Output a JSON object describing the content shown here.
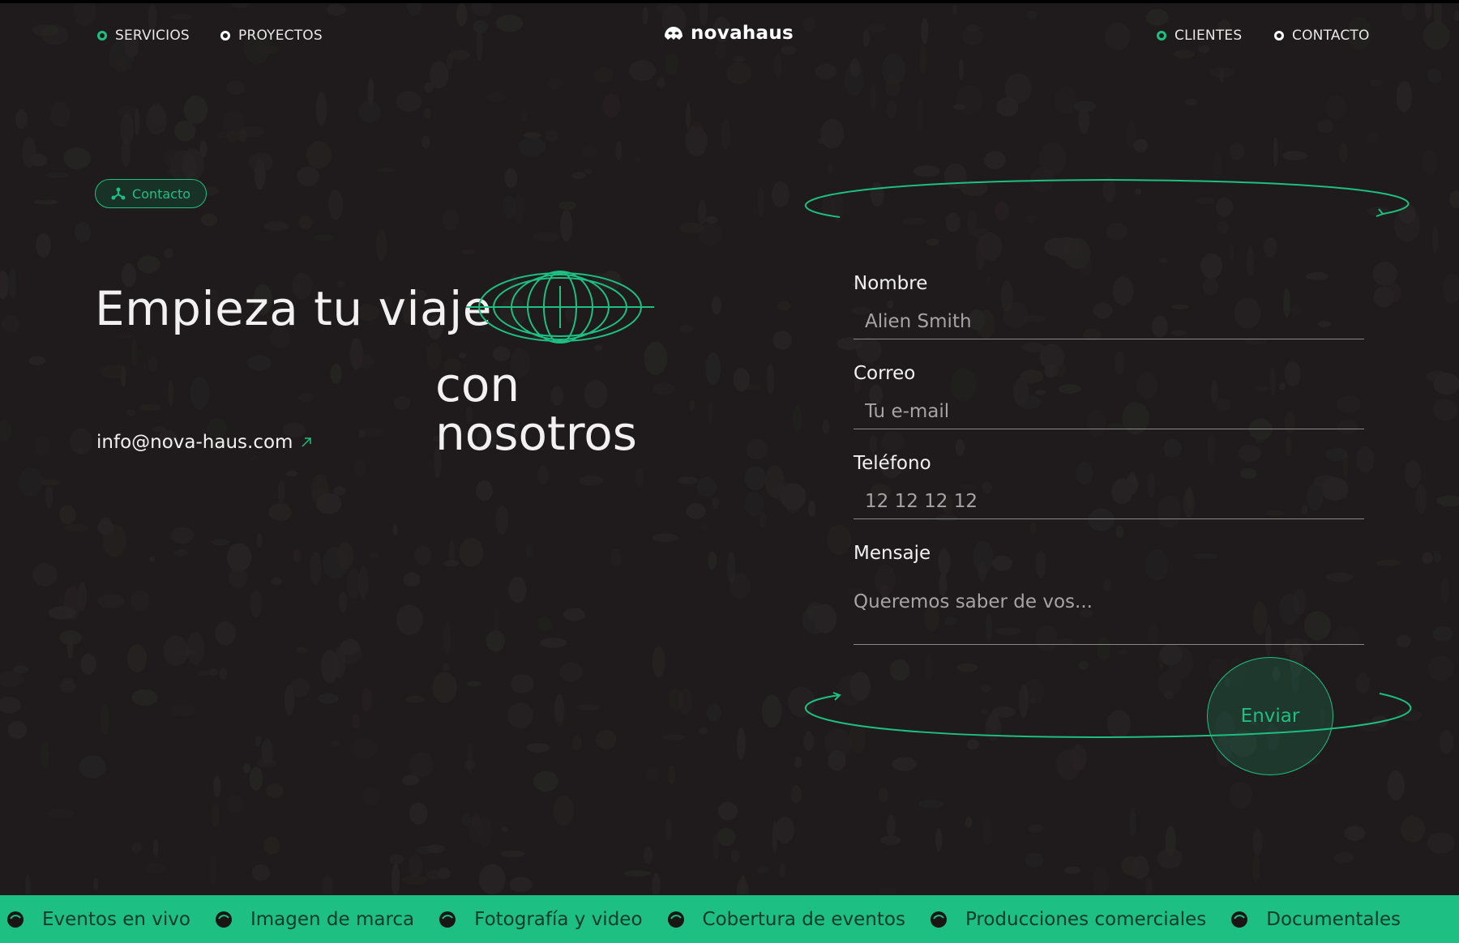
{
  "brand": {
    "name": "novahaus",
    "accent": "#1dbf82",
    "background": "#1f1b1c"
  },
  "nav": {
    "left": [
      {
        "label": "SERVICIOS",
        "dot": "green"
      },
      {
        "label": "PROYECTOS",
        "dot": "white"
      }
    ],
    "right": [
      {
        "label": "CLIENTES",
        "dot": "green"
      },
      {
        "label": "CONTACTO",
        "dot": "white"
      }
    ]
  },
  "hero": {
    "pill_label": "Contacto",
    "headline_line1": "Empieza tu viaje",
    "headline_line2": "con",
    "headline_line3": "nosotros",
    "email": "info@nova-haus.com",
    "icons": {
      "pill": "people-nodes-icon",
      "globe": "globe-icon",
      "email": "arrow-up-right-icon"
    }
  },
  "form": {
    "fields": [
      {
        "label": "Nombre",
        "placeholder": "Alien Smith"
      },
      {
        "label": "Correo",
        "placeholder": "Tu e-mail"
      },
      {
        "label": "Teléfono",
        "placeholder": "12 12 12 12"
      }
    ],
    "message": {
      "label": "Mensaje",
      "placeholder": "Queremos saber de vos..."
    },
    "submit_label": "Enviar"
  },
  "ticker": {
    "items": [
      "Eventos en vivo",
      "Imagen de marca",
      "Fotografía y video",
      "Cobertura de eventos",
      "Producciones comerciales",
      "Documentales"
    ]
  }
}
